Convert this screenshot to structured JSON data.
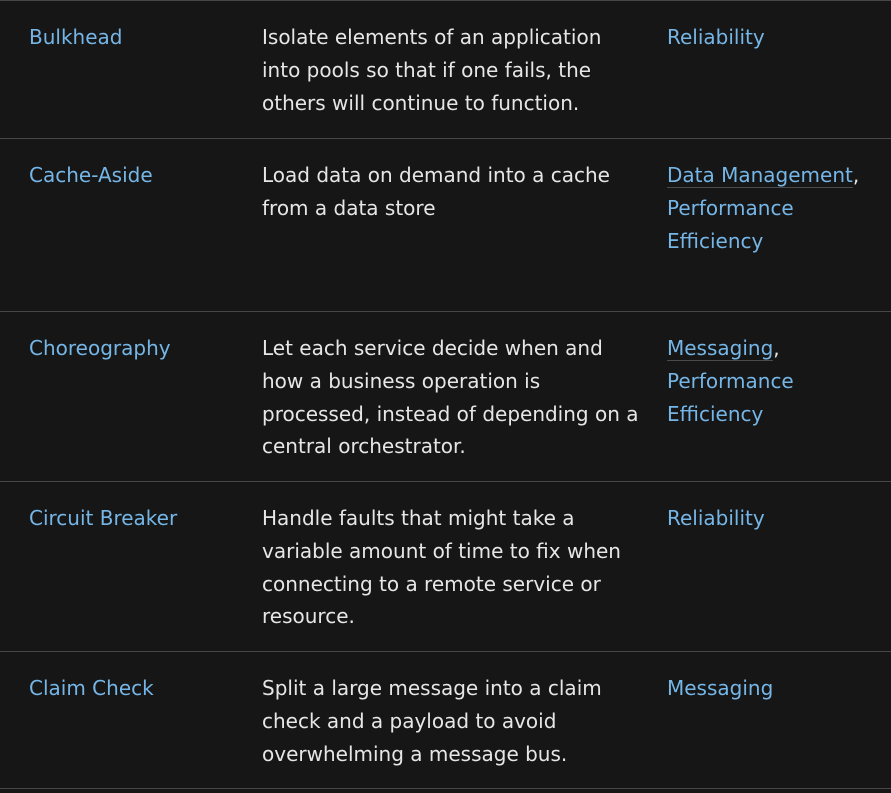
{
  "colors": {
    "background": "#161616",
    "text": "#e6e6e6",
    "link": "#75b6e7",
    "divider": "#474747"
  },
  "rows": [
    {
      "name": "Bulkhead",
      "description": "Isolate elements of an application into pools so that if one fails, the others will continue to function.",
      "categories": [
        "Reliability"
      ]
    },
    {
      "name": "Cache-Aside",
      "description": "Load data on demand into a cache from a data store",
      "categories": [
        "Data Management",
        "Performance Efficiency"
      ]
    },
    {
      "name": "Choreography",
      "description": "Let each service decide when and how a business operation is processed, instead of depending on a central orchestrator.",
      "categories": [
        "Messaging",
        "Performance Efficiency"
      ]
    },
    {
      "name": "Circuit Breaker",
      "description": "Handle faults that might take a variable amount of time to fix when connecting to a remote service or resource.",
      "categories": [
        "Reliability"
      ]
    },
    {
      "name": "Claim Check",
      "description": "Split a large message into a claim check and a payload to avoid overwhelming a message bus.",
      "categories": [
        "Messaging"
      ]
    }
  ],
  "separator": ","
}
